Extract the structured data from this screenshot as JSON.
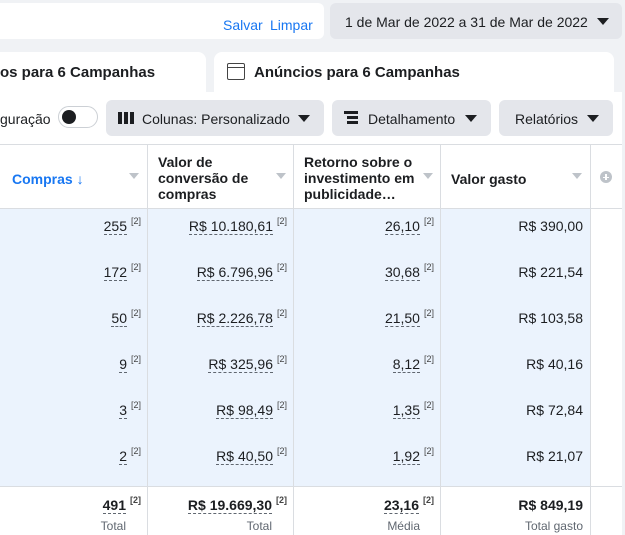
{
  "header": {
    "save_label": "Salvar",
    "clear_label": "Limpar",
    "date_range": "1 de Mar de 2022 a 31 de Mar de 2022"
  },
  "tabs": {
    "campaigns_label": "os para 6 Campanhas",
    "ads_label": "Anúncios para 6 Campanhas"
  },
  "toolbar": {
    "configuration_label": "guração",
    "columns_label": "Colunas: Personalizado",
    "breakdown_label": "Detalhamento",
    "reports_label": "Relatórios"
  },
  "table": {
    "columns": [
      "Compras ↓",
      "Valor de conversão de compras",
      "Retorno sobre o investimento em publicidade…",
      "Valor gasto"
    ],
    "header_lines": {
      "conversion": [
        "Valor de",
        "conversão de",
        "compras"
      ],
      "roas": [
        "Retorno sobre o",
        "investimento em",
        "publicidade…"
      ]
    },
    "superscript": "[2]",
    "rows": [
      {
        "purchases": "255",
        "conversion_value": "R$ 10.180,61",
        "roas": "26,10",
        "spent": "R$ 390,00"
      },
      {
        "purchases": "172",
        "conversion_value": "R$ 6.796,96",
        "roas": "30,68",
        "spent": "R$ 221,54"
      },
      {
        "purchases": "50",
        "conversion_value": "R$ 2.226,78",
        "roas": "21,50",
        "spent": "R$ 103,58"
      },
      {
        "purchases": "9",
        "conversion_value": "R$ 325,96",
        "roas": "8,12",
        "spent": "R$ 40,16"
      },
      {
        "purchases": "3",
        "conversion_value": "R$ 98,49",
        "roas": "1,35",
        "spent": "R$ 72,84"
      },
      {
        "purchases": "2",
        "conversion_value": "R$ 40,50",
        "roas": "1,92",
        "spent": "R$ 21,07"
      }
    ],
    "totals": {
      "purchases": "491",
      "purchases_caption": "Total",
      "conversion_value": "R$ 19.669,30",
      "conversion_caption": "Total",
      "roas": "23,16",
      "roas_caption": "Média",
      "spent": "R$ 849,19",
      "spent_caption": "Total gasto"
    }
  },
  "colors": {
    "accent": "#1877f2",
    "row_highlight": "#ebf3fd",
    "button_bg": "#e4e6eb"
  }
}
